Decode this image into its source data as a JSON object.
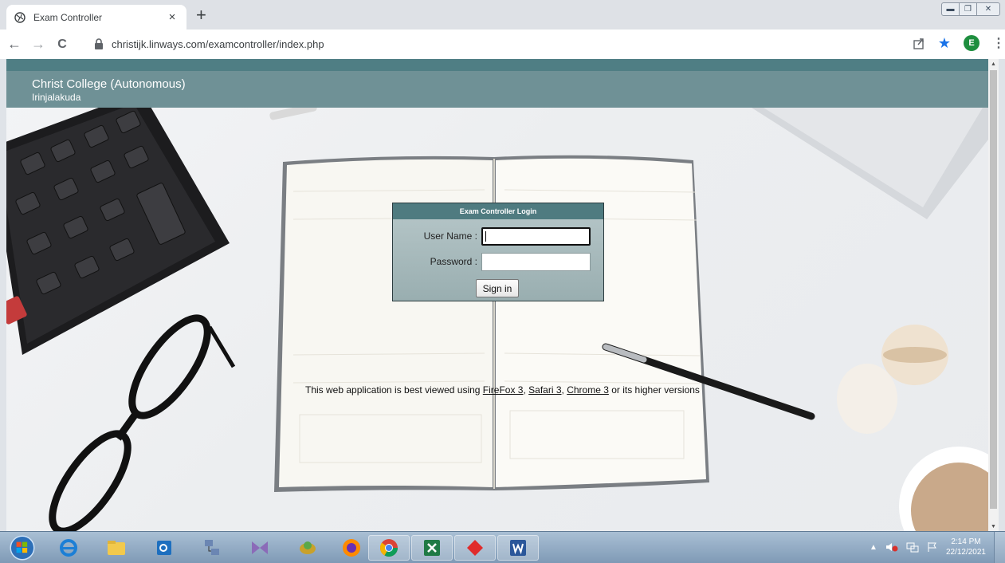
{
  "browser": {
    "tab_title": "Exam Controller",
    "tab_close": "×",
    "new_tab": "+",
    "url": "christijk.linways.com/examcontroller/index.php",
    "avatar_letter": "E",
    "back": "←",
    "forward": "→",
    "reload": "C",
    "star": "★",
    "menu": "⋮"
  },
  "header": {
    "college": "Christ College (Autonomous)",
    "place": "Irinjalakuda"
  },
  "login": {
    "title": "Exam Controller Login",
    "username_label": "User Name :",
    "password_label": "Password :",
    "username_value": "",
    "password_value": "",
    "signin_label": "Sign in"
  },
  "notice": {
    "prefix": "This web application is best viewed using ",
    "firefox": "FireFox 3",
    "sep1": ", ",
    "safari": "Safari 3",
    "sep2": ", ",
    "chrome": "Chrome 3",
    "suffix": " or its higher versions"
  },
  "taskbar": {
    "time": "2:14 PM",
    "date": "22/12/2021",
    "tray_arrow": "▲"
  },
  "scroll": {
    "up": "▲",
    "down": "▼"
  },
  "colors": {
    "header_bg": "#6f9196",
    "header_strip": "#4f7e84",
    "login_head": "#4f7b80",
    "avatar": "#1e8e3e"
  }
}
